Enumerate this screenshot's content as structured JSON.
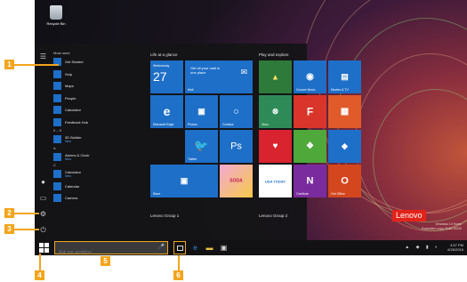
{
  "desktop": {
    "recycle_bin": "Recycle Bin",
    "brand_logo": "Lenovo",
    "watermark": [
      "Windows 10 Home",
      "Evaluation copy. Build 10240"
    ]
  },
  "start_menu": {
    "most_used_label": "Most used",
    "apps": [
      {
        "label": "Get Started",
        "sub": ""
      },
      {
        "label": "Snip",
        "sub": ""
      },
      {
        "label": "Maps",
        "sub": ""
      },
      {
        "label": "People",
        "sub": ""
      },
      {
        "label": "Calculator",
        "sub": ""
      },
      {
        "label": "Feedback Hub",
        "sub": ""
      }
    ],
    "section_0_9": "0 – 9",
    "app_3d": {
      "label": "3D Builder",
      "sub": "New"
    },
    "section_a": "A",
    "app_alarms": {
      "label": "Alarms & Clock",
      "sub": "New"
    },
    "section_c": "C",
    "app_calculator2": {
      "label": "Calculator",
      "sub": "New"
    },
    "app_calendar": {
      "label": "Calendar",
      "sub": ""
    },
    "app_camera": {
      "label": "Camera",
      "sub": ""
    }
  },
  "tiles": {
    "group1": "Life at a glance",
    "group2": "Play and explore",
    "group3": "Lenovo Group 1",
    "group4": "Lenovo Group 2",
    "calendar_day": "Wednesday",
    "calendar_num": "27",
    "mail_text": "Get all your mail in one place",
    "mail_label": "Mail",
    "edge_label": "Microsoft Edge",
    "photos_label": "Photos",
    "cortana_label": "Cortana",
    "twitter_label": "Twitter",
    "ps_glyph": "Ps",
    "store_label": "Store",
    "candy_glyph": "SODA",
    "usa_glyph": "USA TODAY",
    "onenote_label": "OneNote",
    "office_label": "Get Office",
    "xbox_label": "Xbox",
    "groove_label": "Groove Music",
    "movies_label": "Movies & TV"
  },
  "taskbar": {
    "search_placeholder": "Ask me anything",
    "time": "4:57 PM",
    "date": "6/26/2016"
  },
  "callouts": [
    "1",
    "2",
    "3",
    "4",
    "5",
    "6"
  ],
  "colors": {
    "callout": "#f2a51d",
    "tile_blue": "#1e6fc8",
    "start_bg": "#141416"
  }
}
